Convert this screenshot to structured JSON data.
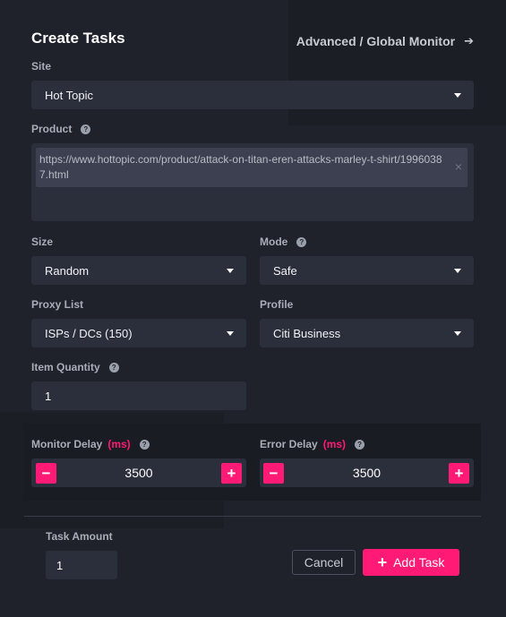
{
  "header": {
    "title": "Create Tasks",
    "advanced_link": "Advanced / Global Monitor"
  },
  "site": {
    "label": "Site",
    "value": "Hot Topic"
  },
  "product": {
    "label": "Product",
    "url": "https://www.hottopic.com/product/attack-on-titan-eren-attacks-marley-t-shirt/19960387.html"
  },
  "size": {
    "label": "Size",
    "value": "Random"
  },
  "mode": {
    "label": "Mode",
    "value": "Safe"
  },
  "proxy_list": {
    "label": "Proxy List",
    "value": "ISPs / DCs (150)"
  },
  "profile": {
    "label": "Profile",
    "value": "Citi Business"
  },
  "item_quantity": {
    "label": "Item Quantity",
    "value": "1"
  },
  "monitor_delay": {
    "label": "Monitor Delay",
    "unit": "(ms)",
    "value": "3500"
  },
  "error_delay": {
    "label": "Error Delay",
    "unit": "(ms)",
    "value": "3500"
  },
  "task_amount": {
    "label": "Task Amount",
    "value": "1"
  },
  "buttons": {
    "cancel": "Cancel",
    "add_task": "Add Task"
  },
  "colors": {
    "accent": "#ff1a75",
    "background": "#1f222b",
    "field": "#2b2e3b"
  }
}
